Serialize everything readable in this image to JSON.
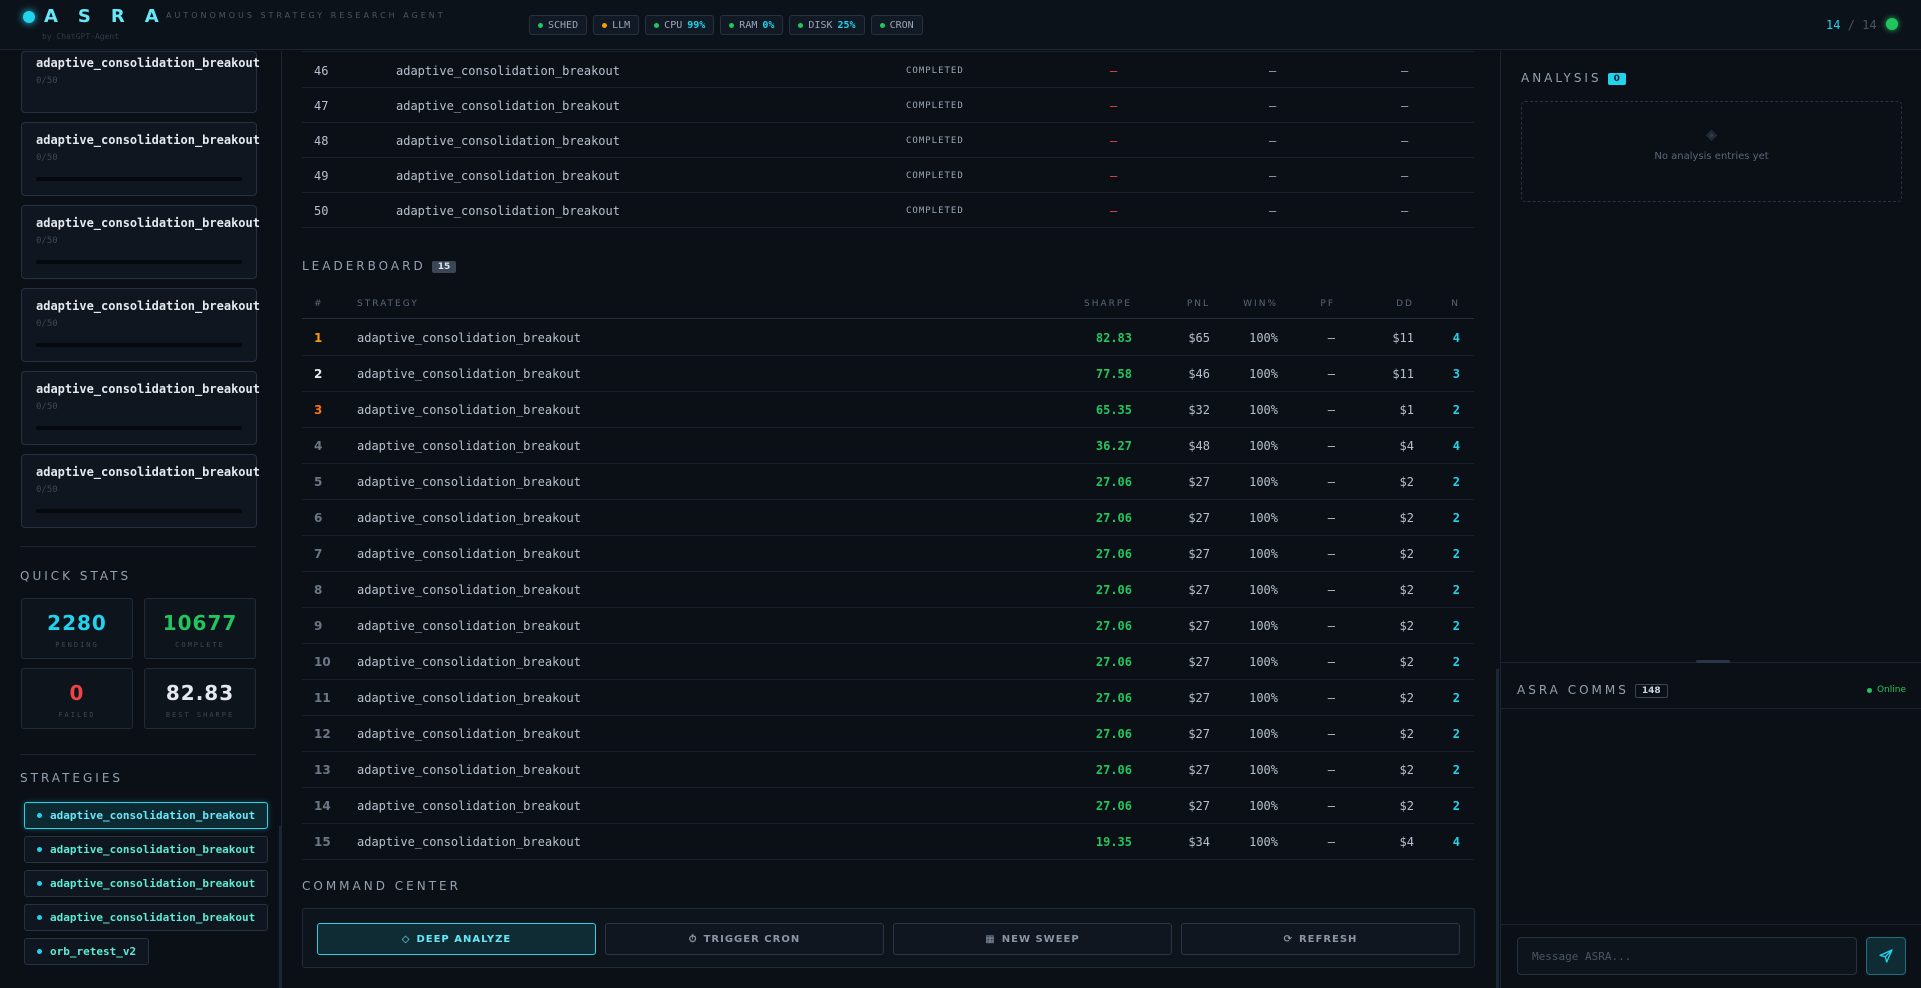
{
  "header": {
    "logo": "ASRA",
    "tagline": "AUTONOMOUS STRATEGY RESEARCH AGENT",
    "byline": "by ChatGPT-Agent",
    "pills": [
      {
        "label": "SCHED",
        "value": "",
        "status": "ok"
      },
      {
        "label": "LLM",
        "value": "",
        "status": "warn"
      },
      {
        "label": "CPU",
        "value": "99%",
        "status": "ok"
      },
      {
        "label": "RAM",
        "value": "0%",
        "status": "ok"
      },
      {
        "label": "DISK",
        "value": "25%",
        "status": "ok"
      },
      {
        "label": "CRON",
        "value": "",
        "status": "ok"
      }
    ],
    "counter_current": "14",
    "counter_sep": "/",
    "counter_total": "14"
  },
  "sweeps": [
    {
      "name": "adaptive_consolidation_breakout",
      "count": "0/50",
      "progress": 0
    },
    {
      "name": "adaptive_consolidation_breakout",
      "count": "0/50",
      "progress": 0
    },
    {
      "name": "adaptive_consolidation_breakout",
      "count": "0/50",
      "progress": 0
    },
    {
      "name": "adaptive_consolidation_breakout",
      "count": "0/50",
      "progress": 0
    },
    {
      "name": "adaptive_consolidation_breakout",
      "count": "0/50",
      "progress": 0
    },
    {
      "name": "adaptive_consolidation_breakout",
      "count": "0/50",
      "progress": 0
    }
  ],
  "quick_stats": {
    "title": "QUICK STATS",
    "pending": {
      "value": "2280",
      "label": "PENDING"
    },
    "complete": {
      "value": "10677",
      "label": "COMPLETE"
    },
    "failed": {
      "value": "0",
      "label": "FAILED"
    },
    "best_sharpe": {
      "value": "82.83",
      "label": "BEST SHARPE"
    }
  },
  "strategies": {
    "title": "STRATEGIES",
    "items": [
      {
        "name": "adaptive_consolidation_breakout",
        "active": true
      },
      {
        "name": "adaptive_consolidation_breakout",
        "active": false
      },
      {
        "name": "adaptive_consolidation_breakout",
        "active": false
      },
      {
        "name": "adaptive_consolidation_breakout",
        "active": false
      },
      {
        "name": "orb_retest_v2",
        "active": false
      }
    ]
  },
  "jobs": [
    {
      "id": "46",
      "strategy": "adaptive_consolidation_breakout",
      "status": "COMPLETED",
      "c1": "—",
      "c2": "—",
      "c3": "—"
    },
    {
      "id": "47",
      "strategy": "adaptive_consolidation_breakout",
      "status": "COMPLETED",
      "c1": "—",
      "c2": "—",
      "c3": "—"
    },
    {
      "id": "48",
      "strategy": "adaptive_consolidation_breakout",
      "status": "COMPLETED",
      "c1": "—",
      "c2": "—",
      "c3": "—"
    },
    {
      "id": "49",
      "strategy": "adaptive_consolidation_breakout",
      "status": "COMPLETED",
      "c1": "—",
      "c2": "—",
      "c3": "—"
    },
    {
      "id": "50",
      "strategy": "adaptive_consolidation_breakout",
      "status": "COMPLETED",
      "c1": "—",
      "c2": "—",
      "c3": "—"
    }
  ],
  "leaderboard": {
    "title": "LEADERBOARD",
    "count": "15",
    "columns": [
      "#",
      "STRATEGY",
      "SHARPE",
      "PNL",
      "WIN%",
      "PF",
      "DD",
      "N"
    ],
    "rows": [
      {
        "rank": "1",
        "strategy": "adaptive_consolidation_breakout",
        "sharpe": "82.83",
        "pnl": "$65",
        "win": "100%",
        "pf": "—",
        "dd": "$11",
        "n": "4"
      },
      {
        "rank": "2",
        "strategy": "adaptive_consolidation_breakout",
        "sharpe": "77.58",
        "pnl": "$46",
        "win": "100%",
        "pf": "—",
        "dd": "$11",
        "n": "3"
      },
      {
        "rank": "3",
        "strategy": "adaptive_consolidation_breakout",
        "sharpe": "65.35",
        "pnl": "$32",
        "win": "100%",
        "pf": "—",
        "dd": "$1",
        "n": "2"
      },
      {
        "rank": "4",
        "strategy": "adaptive_consolidation_breakout",
        "sharpe": "36.27",
        "pnl": "$48",
        "win": "100%",
        "pf": "—",
        "dd": "$4",
        "n": "4"
      },
      {
        "rank": "5",
        "strategy": "adaptive_consolidation_breakout",
        "sharpe": "27.06",
        "pnl": "$27",
        "win": "100%",
        "pf": "—",
        "dd": "$2",
        "n": "2"
      },
      {
        "rank": "6",
        "strategy": "adaptive_consolidation_breakout",
        "sharpe": "27.06",
        "pnl": "$27",
        "win": "100%",
        "pf": "—",
        "dd": "$2",
        "n": "2"
      },
      {
        "rank": "7",
        "strategy": "adaptive_consolidation_breakout",
        "sharpe": "27.06",
        "pnl": "$27",
        "win": "100%",
        "pf": "—",
        "dd": "$2",
        "n": "2"
      },
      {
        "rank": "8",
        "strategy": "adaptive_consolidation_breakout",
        "sharpe": "27.06",
        "pnl": "$27",
        "win": "100%",
        "pf": "—",
        "dd": "$2",
        "n": "2"
      },
      {
        "rank": "9",
        "strategy": "adaptive_consolidation_breakout",
        "sharpe": "27.06",
        "pnl": "$27",
        "win": "100%",
        "pf": "—",
        "dd": "$2",
        "n": "2"
      },
      {
        "rank": "10",
        "strategy": "adaptive_consolidation_breakout",
        "sharpe": "27.06",
        "pnl": "$27",
        "win": "100%",
        "pf": "—",
        "dd": "$2",
        "n": "2"
      },
      {
        "rank": "11",
        "strategy": "adaptive_consolidation_breakout",
        "sharpe": "27.06",
        "pnl": "$27",
        "win": "100%",
        "pf": "—",
        "dd": "$2",
        "n": "2"
      },
      {
        "rank": "12",
        "strategy": "adaptive_consolidation_breakout",
        "sharpe": "27.06",
        "pnl": "$27",
        "win": "100%",
        "pf": "—",
        "dd": "$2",
        "n": "2"
      },
      {
        "rank": "13",
        "strategy": "adaptive_consolidation_breakout",
        "sharpe": "27.06",
        "pnl": "$27",
        "win": "100%",
        "pf": "—",
        "dd": "$2",
        "n": "2"
      },
      {
        "rank": "14",
        "strategy": "adaptive_consolidation_breakout",
        "sharpe": "27.06",
        "pnl": "$27",
        "win": "100%",
        "pf": "—",
        "dd": "$2",
        "n": "2"
      },
      {
        "rank": "15",
        "strategy": "adaptive_consolidation_breakout",
        "sharpe": "19.35",
        "pnl": "$34",
        "win": "100%",
        "pf": "—",
        "dd": "$4",
        "n": "4"
      }
    ]
  },
  "command_center": {
    "title": "COMMAND CENTER",
    "buttons": [
      {
        "icon": "◇",
        "label": "DEEP ANALYZE"
      },
      {
        "icon": "⏱",
        "label": "TRIGGER CRON"
      },
      {
        "icon": "▦",
        "label": "NEW SWEEP"
      },
      {
        "icon": "⟳",
        "label": "REFRESH"
      }
    ]
  },
  "analysis": {
    "title": "ANALYSIS",
    "count": "0",
    "empty_icon": "◈",
    "empty_text": "No analysis entries yet"
  },
  "comms": {
    "title": "ASRA COMMS",
    "count": "148",
    "status": "Online",
    "placeholder": "Message ASRA..."
  },
  "colors": {
    "accent": "#22d3ee",
    "success": "#22c55e",
    "danger": "#ef4444",
    "warn": "#f59e0b",
    "background": "#0b1017"
  }
}
